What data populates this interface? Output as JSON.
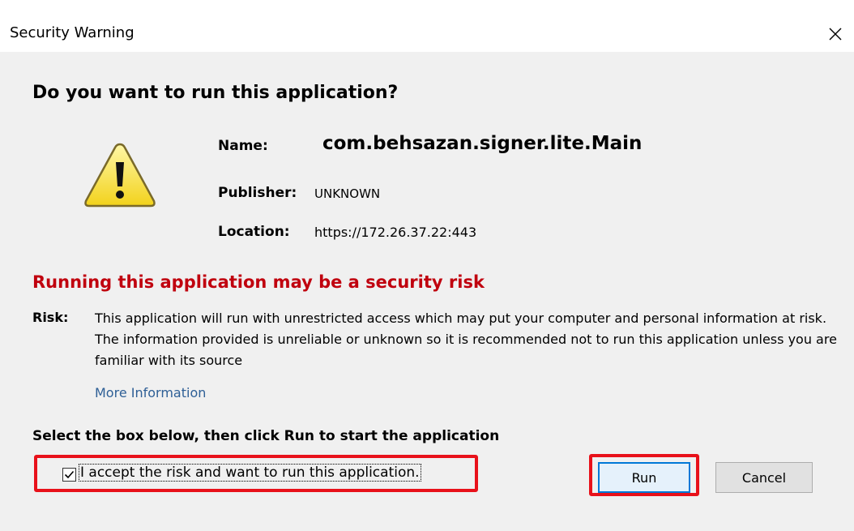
{
  "window": {
    "title": "Security Warning"
  },
  "dialog": {
    "headline": "Do you want to run this application?",
    "fields": {
      "name_label": "Name:",
      "name_value": "com.behsazan.signer.lite.Main",
      "publisher_label": "Publisher:",
      "publisher_value": "UNKNOWN",
      "location_label": "Location:",
      "location_value": "https://172.26.37.22:443"
    },
    "risk_heading": "Running this application may be a security risk",
    "risk_label": "Risk:",
    "risk_text": "This application will run with unrestricted access which may put your computer and personal information at risk. The information provided is unreliable or unknown so it is recommended not to run this application unless you are familiar with its source",
    "more_info": "More Information",
    "instruction": "Select the box below, then click Run to start the application",
    "accept_label": "I accept the risk and want to run this application.",
    "accept_checked": true,
    "run_label": "Run",
    "cancel_label": "Cancel"
  },
  "colors": {
    "risk_red": "#c0000e",
    "link_blue": "#2e5f96",
    "highlight_red": "#e8111a",
    "warning_yellow": "#f6e14b"
  },
  "icons": {
    "warning": "warning-triangle-icon",
    "close": "close-icon",
    "check": "checkmark-icon"
  }
}
